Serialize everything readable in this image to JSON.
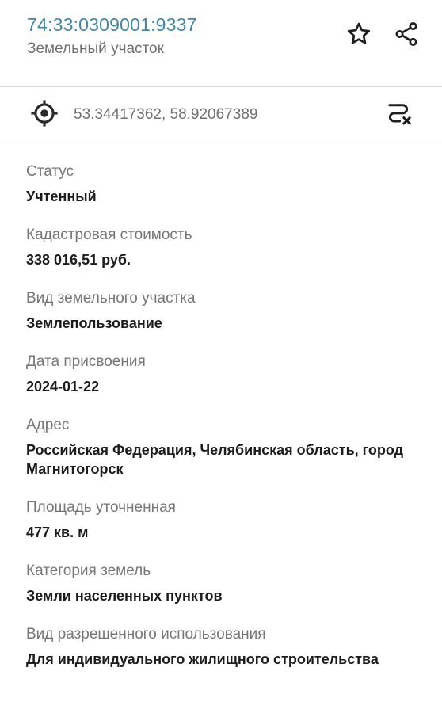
{
  "header": {
    "cadastral_number": "74:33:0309001:9337",
    "object_type": "Земельный участок",
    "favorite_icon": "star-icon",
    "share_icon": "share-icon"
  },
  "location": {
    "icon": "target-icon",
    "coordinates": "53.34417362, 58.92067389",
    "route_icon": "route-clear-icon"
  },
  "fields": [
    {
      "label": "Статус",
      "value": "Учтенный"
    },
    {
      "label": "Кадастровая стоимость",
      "value": "338 016,51 руб."
    },
    {
      "label": "Вид земельного участка",
      "value": "Землепользование"
    },
    {
      "label": "Дата присвоения",
      "value": "2024-01-22"
    },
    {
      "label": "Адрес",
      "value": "Российская Федерация, Челябинская область, город Магнитогорск"
    },
    {
      "label": "Площадь уточненная",
      "value": "477 кв. м"
    },
    {
      "label": "Категория земель",
      "value": "Земли населенных пунктов"
    },
    {
      "label": "Вид разрешенного использования",
      "value": "Для индивидуального жилищного строительства"
    }
  ],
  "colors": {
    "accent": "#3f86a6",
    "label": "#767676",
    "value": "#1c1c1c",
    "divider": "#dcdcdc"
  }
}
